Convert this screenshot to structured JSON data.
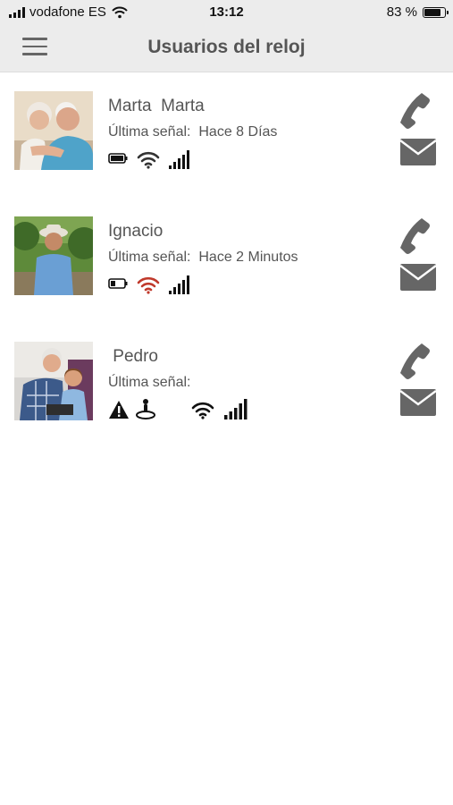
{
  "status_bar": {
    "carrier": "vodafone ES",
    "time": "13:12",
    "battery_percent": "83 %"
  },
  "header": {
    "title": "Usuarios del reloj",
    "menu_icon": "hamburger-menu-icon"
  },
  "users": [
    {
      "name": "Marta  Marta",
      "last_signal_label": "Última señal:",
      "last_signal_value": "Hace 8 Días",
      "battery_level": 1.0,
      "wifi_color": "#333333",
      "cell_bars": 4
    },
    {
      "name": "Ignacio",
      "last_signal_label": "Última señal:",
      "last_signal_value": "Hace 2 Minutos",
      "battery_level": 0.3,
      "wifi_color": "#c0392b",
      "cell_bars": 4
    },
    {
      "name": " Pedro",
      "last_signal_label": "Última señal:",
      "last_signal_value": "",
      "has_alert": true,
      "has_location": true,
      "wifi_color": "#111111",
      "cell_bars": 5
    }
  ],
  "colors": {
    "header_bg": "#ececec",
    "icon_gray": "#666666",
    "wifi_alert": "#c0392b"
  }
}
